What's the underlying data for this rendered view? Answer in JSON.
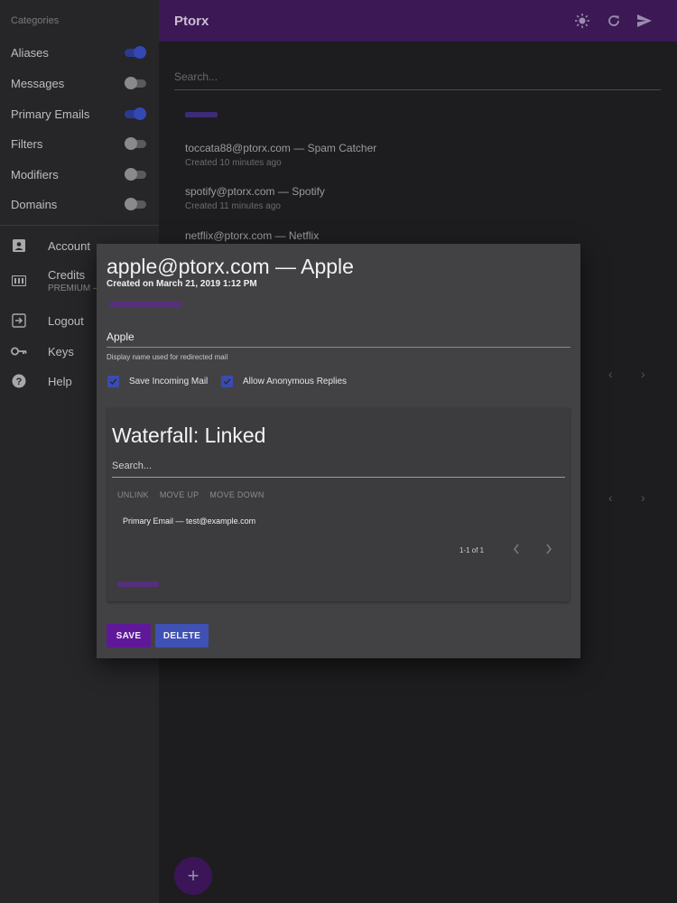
{
  "sidebar": {
    "categories_title": "Categories",
    "categories": [
      {
        "label": "Aliases",
        "on": true
      },
      {
        "label": "Messages",
        "on": false
      },
      {
        "label": "Primary Emails",
        "on": true
      },
      {
        "label": "Filters",
        "on": false
      },
      {
        "label": "Modifiers",
        "on": false
      },
      {
        "label": "Domains",
        "on": false
      }
    ],
    "nav": [
      {
        "label": "Account",
        "icon": "account-box-icon"
      },
      {
        "label": "Credits",
        "sub": "PREMIUM —",
        "icon": "credits-card-icon"
      },
      {
        "label": "Logout",
        "icon": "logout-icon"
      },
      {
        "label": "Keys",
        "icon": "key-icon"
      },
      {
        "label": "Help",
        "icon": "help-icon"
      }
    ]
  },
  "appbar": {
    "title": "Ptorx",
    "icons": [
      "brightness-icon",
      "refresh-icon",
      "send-icon"
    ]
  },
  "main": {
    "search_placeholder": "Search...",
    "aliases": [
      {
        "title": "toccata88@ptorx.com — Spam Catcher",
        "created": "Created 10 minutes ago"
      },
      {
        "title": "spotify@ptorx.com — Spotify",
        "created": "Created 11 minutes ago"
      },
      {
        "title": "netflix@ptorx.com — Netflix"
      }
    ]
  },
  "dialog": {
    "title": "apple@ptorx.com — Apple",
    "created": "Created on March 21, 2019 1:12 PM",
    "name_value": "Apple",
    "name_help": "Display name used for redirected mail",
    "checkboxes": [
      {
        "label": "Save Incoming Mail",
        "checked": true
      },
      {
        "label": "Allow Anonymous Replies",
        "checked": true
      }
    ],
    "waterfall": {
      "title": "Waterfall: Linked",
      "search_placeholder": "Search...",
      "actions": [
        "UNLINK",
        "MOVE UP",
        "MOVE DOWN"
      ],
      "rows": [
        "Primary Email — test@example.com"
      ],
      "pagination": "1-1 of 1"
    },
    "save_label": "SAVE",
    "delete_label": "DELETE"
  },
  "colors": {
    "appbar": "#3c1855",
    "accent_purple": "#5f189a",
    "accent_blue": "#3f51b5"
  }
}
